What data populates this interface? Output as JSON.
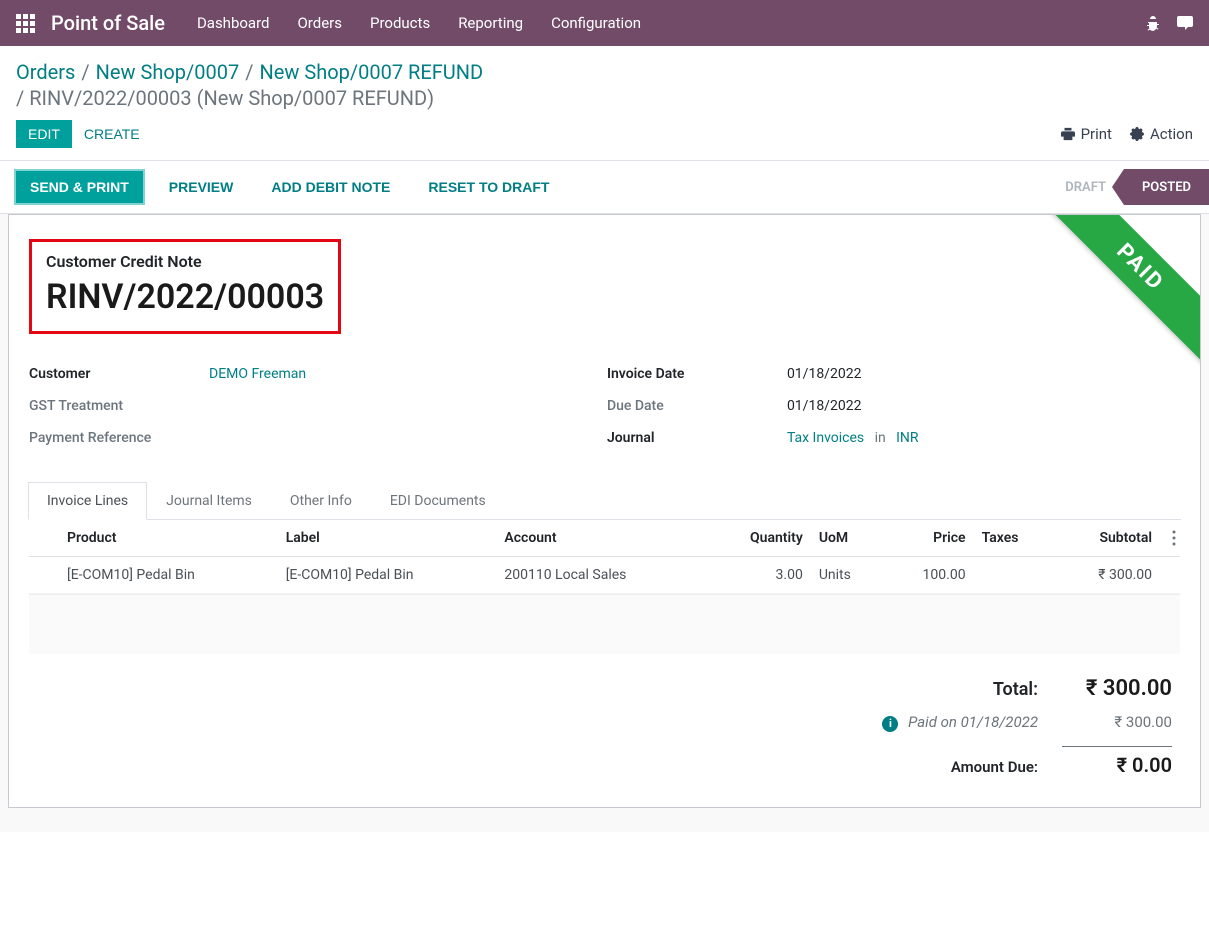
{
  "nav": {
    "brand": "Point of Sale",
    "items": [
      "Dashboard",
      "Orders",
      "Products",
      "Reporting",
      "Configuration"
    ]
  },
  "breadcrumb": {
    "orders": "Orders",
    "shop": "New Shop/0007",
    "refund": "New Shop/0007 REFUND",
    "current_prefix": "/ ",
    "current": "RINV/2022/00003 (New Shop/0007 REFUND)",
    "sep": "/"
  },
  "controls": {
    "edit": "Edit",
    "create": "Create",
    "print": "Print",
    "action": "Action"
  },
  "statusbar": {
    "send_print": "Send & Print",
    "preview": "Preview",
    "add_debit_note": "Add Debit Note",
    "reset_to_draft": "Reset to Draft",
    "draft": "DRAFT",
    "posted": "POSTED"
  },
  "ribbon": "PAID",
  "title": {
    "label": "Customer Credit Note",
    "value": "RINV/2022/00003"
  },
  "form": {
    "left": {
      "customer_label": "Customer",
      "customer_value": "DEMO Freeman",
      "gst_label": "GST Treatment",
      "gst_value": "",
      "payment_ref_label": "Payment Reference",
      "payment_ref_value": ""
    },
    "right": {
      "invoice_date_label": "Invoice Date",
      "invoice_date_value": "01/18/2022",
      "due_date_label": "Due Date",
      "due_date_value": "01/18/2022",
      "journal_label": "Journal",
      "journal_value": "Tax Invoices",
      "journal_in": "in",
      "journal_currency": "INR"
    }
  },
  "tabs": {
    "invoice_lines": "Invoice Lines",
    "journal_items": "Journal Items",
    "other_info": "Other Info",
    "edi_documents": "EDI Documents"
  },
  "table": {
    "headers": {
      "product": "Product",
      "label": "Label",
      "account": "Account",
      "quantity": "Quantity",
      "uom": "UoM",
      "price": "Price",
      "taxes": "Taxes",
      "subtotal": "Subtotal"
    },
    "rows": [
      {
        "product": "[E-COM10] Pedal Bin",
        "label": "[E-COM10] Pedal Bin",
        "account": "200110 Local Sales",
        "quantity": "3.00",
        "uom": "Units",
        "price": "100.00",
        "taxes": "",
        "subtotal": "₹ 300.00"
      }
    ]
  },
  "totals": {
    "total_label": "Total:",
    "total_value": "₹ 300.00",
    "paid_label": "Paid on 01/18/2022",
    "paid_value": "₹ 300.00",
    "due_label": "Amount Due:",
    "due_value": "₹ 0.00"
  }
}
